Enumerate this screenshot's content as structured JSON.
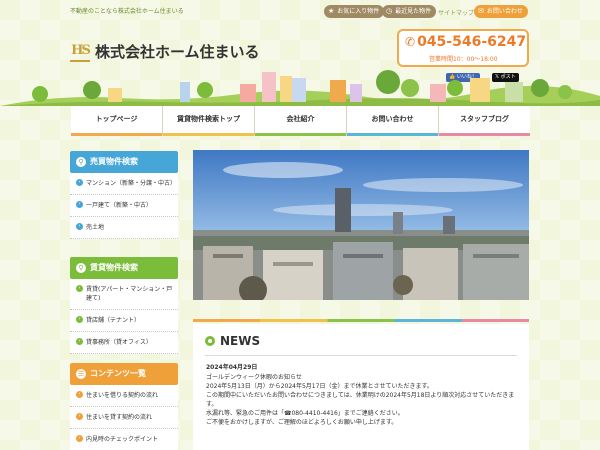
{
  "topbar": {
    "tagline": "不動産のことなら株式会社ホーム住まいる",
    "favorites_label": "お気に入り物件",
    "recent_label": "最近見た物件",
    "sitemap_label": "サイトマップ",
    "contact_label": "お問い合わせ"
  },
  "header": {
    "company_name": "株式会社ホーム住まいる",
    "phone": "045-546-6247",
    "hours": "営業時間10：00～18:00",
    "like_label": "いいね！",
    "post_label": "ポスト"
  },
  "nav": {
    "items": [
      "トップページ",
      "賃貸物件検索トップ",
      "会社紹介",
      "お問い合わせ",
      "スタッフブログ"
    ]
  },
  "sidebar": {
    "sale": {
      "title": "売買物件検索",
      "items": [
        "マンション（新築・分譲・中古）",
        "一戸建て（新築・中古）",
        "売土地"
      ]
    },
    "rent": {
      "title": "賃貸物件検索",
      "items": [
        "賃貸(アパート・マンション・戸建て)",
        "貸店舗（テナント）",
        "貸事務所（貸オフィス）"
      ]
    },
    "contents": {
      "title": "コンテンツ一覧",
      "items": [
        "住まいを借りる契約の流れ",
        "住まいを貸す契約の流れ",
        "内見時のチェックポイント"
      ]
    }
  },
  "news": {
    "title": "NEWS",
    "date": "2024年04月29日",
    "heading": "ゴールデンウィーク休暇のお知らせ",
    "lines": [
      "2024年5月13日（月）から2024年5月17日（金）まで休業とさせていただきます。",
      "この期間中にいただいたお問い合わせにつきましては、休業明けの2024年5月18日より順次対応させていただきます。",
      "水漏れ等、緊急のご用件は「☎080-4410-4416」までご連絡ください。",
      "ご不便をおかけしますが、ご理解のほどよろしくお願い申し上げます。"
    ]
  },
  "colors": {
    "accent_orange": "#f0a039",
    "sale_blue": "#47a6d8",
    "rent_green": "#7bbd3b",
    "phone_orange": "#ee7a28"
  }
}
